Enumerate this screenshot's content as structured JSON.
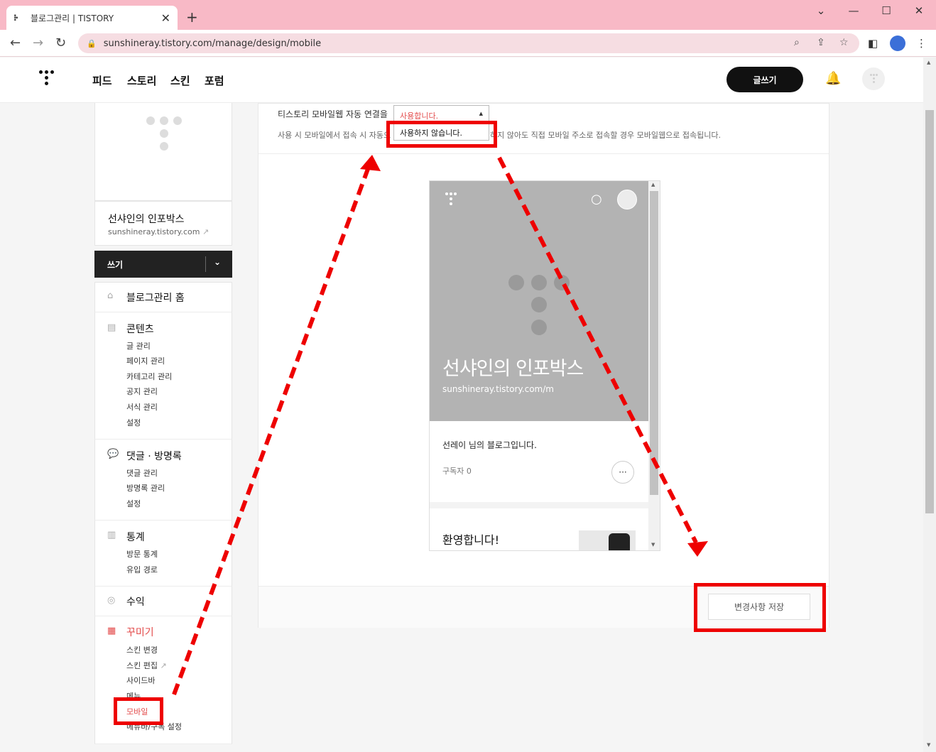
{
  "browser": {
    "tab_title": "블로그관리 | TISTORY",
    "tab_close": "✕",
    "new_tab": "+",
    "url": "sunshineray.tistory.com/manage/design/mobile"
  },
  "header": {
    "nav": [
      "피드",
      "스토리",
      "스킨",
      "포럼"
    ],
    "write_button": "글쓰기"
  },
  "sidebar": {
    "blog_name": "선샤인의 인포박스",
    "blog_url": "sunshineray.tistory.com",
    "write": "쓰기",
    "home": "블로그관리 홈",
    "sections": [
      {
        "title": "콘텐츠",
        "icon": "document-icon",
        "items": [
          "글 관리",
          "페이지 관리",
          "카테고리 관리",
          "공지 관리",
          "서식 관리",
          "설정"
        ]
      },
      {
        "title": "댓글 · 방명록",
        "icon": "chat-icon",
        "items": [
          "댓글 관리",
          "방명록 관리",
          "설정"
        ]
      },
      {
        "title": "통계",
        "icon": "chart-icon",
        "items": [
          "방문 통계",
          "유입 경로"
        ]
      },
      {
        "title": "수익",
        "icon": "coin-icon",
        "items": []
      },
      {
        "title": "꾸미기",
        "icon": "layout-icon",
        "items": [
          "스킨 변경",
          "스킨 편집",
          "사이드바",
          "메뉴",
          "모바일",
          "메뉴바/구독 설정"
        ],
        "active_item": "모바일"
      }
    ]
  },
  "main": {
    "option_label": "티스토리 모바일웹 자동 연결을",
    "select_value": "사용합니다.",
    "dropdown_option": "사용하지 않습니다.",
    "description_left": "사용 시 모바일에서 접속 시 자동으",
    "description_right": "하지 않아도 직접 모바일 주소로 접속할 경우 모바일웹으로 접속됩니다.",
    "save_button": "변경사항 저장"
  },
  "preview": {
    "title": "선샤인의 인포박스",
    "url": "sunshineray.tistory.com/m",
    "intro": "선레이 님의 블로그입니다.",
    "subscribers": "구독자 0",
    "welcome": "환영합니다!"
  },
  "colors": {
    "accent": "#e34a4a",
    "annotation": "#ee0000",
    "tabbar": "#f8b9c6"
  }
}
